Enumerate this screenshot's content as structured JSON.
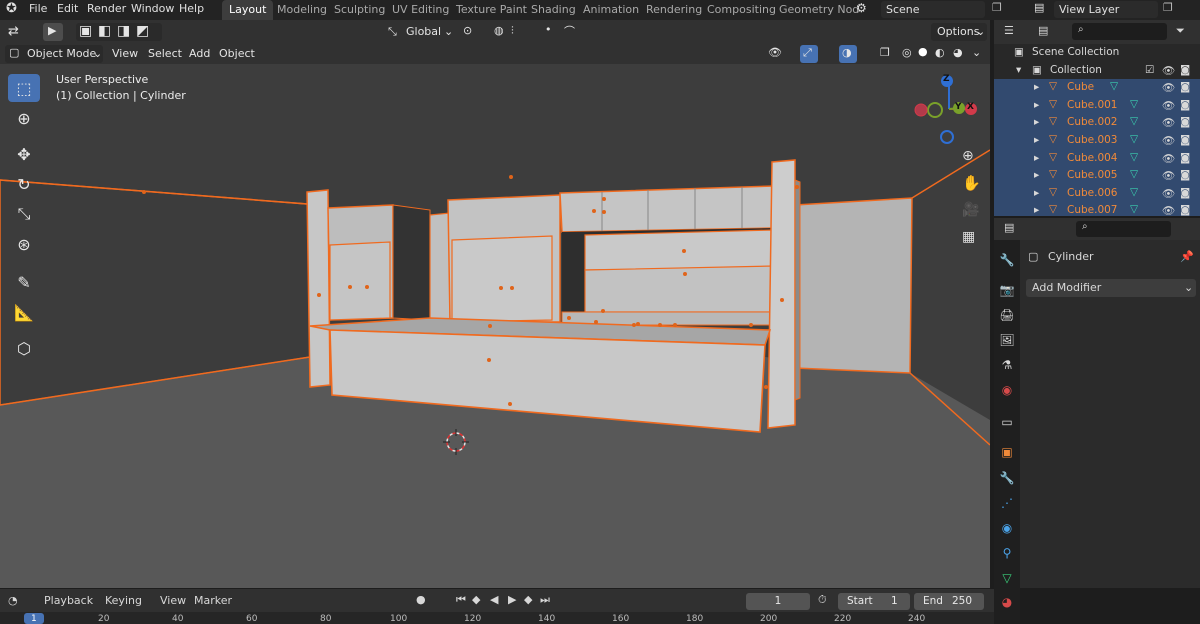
{
  "top_menu": {
    "items": [
      "File",
      "Edit",
      "Render",
      "Window",
      "Help"
    ],
    "workspace_tabs": [
      "Layout",
      "Modeling",
      "Sculpting",
      "UV Editing",
      "Texture Paint",
      "Shading",
      "Animation",
      "Rendering",
      "Compositing",
      "Geometry Nod"
    ],
    "active_tab": "Layout",
    "scene_name": "Scene",
    "view_layer": "View Layer"
  },
  "viewport_header": {
    "mode": "Object Mode",
    "menus": [
      "View",
      "Select",
      "Add",
      "Object"
    ],
    "orientation": "Global",
    "options_label": "Options"
  },
  "viewport": {
    "view_name": "User Perspective",
    "context_line": "(1) Collection | Cylinder",
    "background": "#3d3d3d",
    "selection_color": "#f06a1f"
  },
  "gizmo": {
    "z_label": "Z",
    "y_label": "Y",
    "x_label": "X"
  },
  "outliner": {
    "root": "Scene Collection",
    "collection": "Collection",
    "objects": [
      "Cube",
      "Cube.001",
      "Cube.002",
      "Cube.003",
      "Cube.004",
      "Cube.005",
      "Cube.006",
      "Cube.007"
    ],
    "search_placeholder": ""
  },
  "properties": {
    "object_name": "Cylinder",
    "add_modifier_label": "Add Modifier"
  },
  "timeline": {
    "menus": [
      "Playback",
      "Keying",
      "View",
      "Marker"
    ],
    "current_frame": "1",
    "start_label": "Start",
    "start_value": "1",
    "end_label": "End",
    "end_value": "250",
    "ruler_ticks": [
      "1",
      "20",
      "40",
      "60",
      "80",
      "100",
      "120",
      "140",
      "160",
      "180",
      "200",
      "220",
      "240"
    ]
  },
  "icons": {
    "blender_logo": "blender-logo-icon",
    "select_tool": "cursor-arrow-icon"
  }
}
